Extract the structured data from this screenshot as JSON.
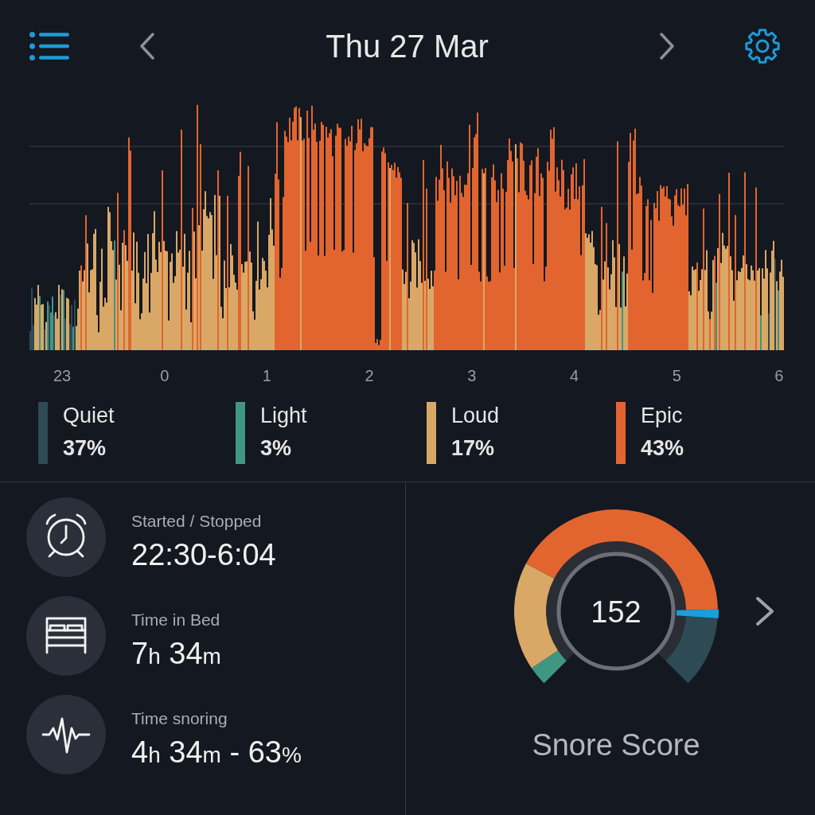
{
  "header": {
    "title": "Thu 27 Mar"
  },
  "chart": {
    "x_labels": [
      "23",
      "0",
      "1",
      "2",
      "3",
      "4",
      "5",
      "6"
    ]
  },
  "legend": [
    {
      "label": "Quiet",
      "percent": "37%",
      "color": "#2e4a55"
    },
    {
      "label": "Light",
      "percent": "3%",
      "color": "#3f9683"
    },
    {
      "label": "Loud",
      "percent": "17%",
      "color": "#d9a866"
    },
    {
      "label": "Epic",
      "percent": "43%",
      "color": "#e2652f"
    }
  ],
  "stats": [
    {
      "kind": "alarm",
      "label": "Started / Stopped",
      "value": [
        {
          "kind": "number",
          "text": "22:30-6:04"
        }
      ]
    },
    {
      "kind": "bed",
      "label": "Time in Bed",
      "value": [
        {
          "kind": "number",
          "text": "7"
        },
        {
          "kind": "unit",
          "text": "h"
        },
        {
          "kind": "number",
          "text": " 34"
        },
        {
          "kind": "unit",
          "text": "m"
        }
      ]
    },
    {
      "kind": "pulse",
      "label": "Time snoring",
      "value": [
        {
          "kind": "number",
          "text": "4"
        },
        {
          "kind": "unit",
          "text": "h"
        },
        {
          "kind": "number",
          "text": " 34"
        },
        {
          "kind": "unit",
          "text": "m"
        },
        {
          "kind": "number",
          "text": " - 63"
        },
        {
          "kind": "unit",
          "text": "%"
        }
      ]
    }
  ],
  "score": {
    "value": "152",
    "label": "Snore Score"
  }
}
